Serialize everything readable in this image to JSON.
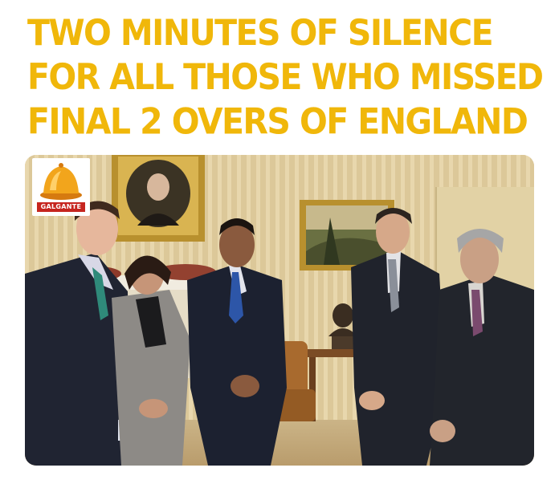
{
  "caption": {
    "lines": [
      "TWO MINUTES OF SILENCE",
      "FOR ALL THOSE WHO MISSED",
      "FINAL 2 OVERS OF ENGLAND"
    ],
    "color": "#f0b70a"
  },
  "watermark": {
    "label": "GALGANTE",
    "icon": "bell-icon"
  }
}
